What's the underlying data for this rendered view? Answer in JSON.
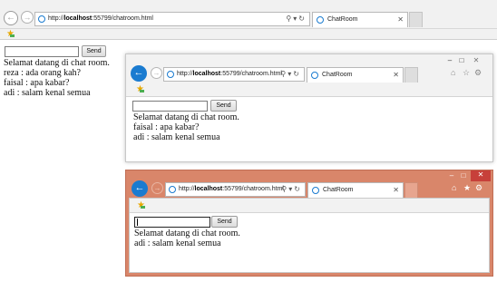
{
  "main": {
    "address": {
      "prefix": "http://",
      "host": "localhost",
      "rest": ":55799/chatroom.html"
    },
    "tab_title": "ChatRoom",
    "send_label": "Send",
    "message_value": "",
    "messages": [
      "Selamat datang di chat room.",
      "reza : ada orang kah?",
      "faisal : apa kabar?",
      "adi : salam kenal semua"
    ]
  },
  "win1": {
    "address": {
      "prefix": "http://",
      "host": "localhost",
      "rest": ":55799/chatroom.html"
    },
    "tab_title": "ChatRoom",
    "send_label": "Send",
    "messages": [
      "Selamat datang di chat room.",
      "faisal : apa kabar?",
      "adi : salam kenal semua"
    ]
  },
  "win2": {
    "address": {
      "prefix": "http://",
      "host": "localhost",
      "rest": ":55799/chatroom.html"
    },
    "tab_title": "ChatRoom",
    "send_label": "Send",
    "messages": [
      "Selamat datang di chat room.",
      "adi : salam kenal semua"
    ]
  },
  "colors": {
    "chrome": "#f1f1f1",
    "active_frame": "#d9866a",
    "back_button": "#1a7bd0"
  },
  "icons": {
    "back": "back-arrow-icon",
    "forward": "forward-arrow-icon",
    "home": "home-icon",
    "favorites": "star-icon",
    "settings": "gear-icon"
  }
}
